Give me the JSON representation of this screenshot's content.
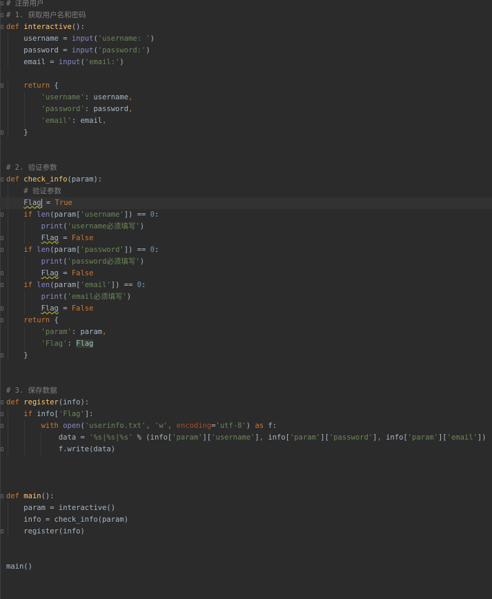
{
  "editor": {
    "language": "python",
    "theme": "dark",
    "current_line": 17,
    "lines": [
      {
        "indent": 0,
        "fold": true,
        "tokens": [
          {
            "t": "# 注册用户",
            "k": "cmt"
          }
        ]
      },
      {
        "indent": 0,
        "fold": true,
        "tokens": [
          {
            "t": "# 1. 获取用户名和密码",
            "k": "cmt"
          }
        ]
      },
      {
        "indent": 0,
        "fold": true,
        "tokens": [
          {
            "t": "def",
            "k": "kw"
          },
          {
            "t": " "
          },
          {
            "t": "interactive",
            "k": "fn"
          },
          {
            "t": "():"
          }
        ]
      },
      {
        "indent": 1,
        "tokens": [
          {
            "t": "username = "
          },
          {
            "t": "input",
            "k": "builtin"
          },
          {
            "t": "("
          },
          {
            "t": "'username: '",
            "k": "str"
          },
          {
            "t": ")"
          }
        ]
      },
      {
        "indent": 1,
        "tokens": [
          {
            "t": "password = "
          },
          {
            "t": "input",
            "k": "builtin"
          },
          {
            "t": "("
          },
          {
            "t": "'password:'",
            "k": "str"
          },
          {
            "t": ")"
          }
        ]
      },
      {
        "indent": 1,
        "tokens": [
          {
            "t": "email = "
          },
          {
            "t": "input",
            "k": "builtin"
          },
          {
            "t": "("
          },
          {
            "t": "'email:'",
            "k": "str"
          },
          {
            "t": ")"
          }
        ]
      },
      {
        "indent": 0,
        "tokens": []
      },
      {
        "indent": 1,
        "fold": true,
        "tokens": [
          {
            "t": "return",
            "k": "kw"
          },
          {
            "t": " {"
          }
        ]
      },
      {
        "indent": 2,
        "tokens": [
          {
            "t": "'username'",
            "k": "str"
          },
          {
            "t": ": username"
          },
          {
            "t": ",",
            "k": "kw"
          }
        ]
      },
      {
        "indent": 2,
        "tokens": [
          {
            "t": "'password'",
            "k": "str"
          },
          {
            "t": ": password"
          },
          {
            "t": ",",
            "k": "kw"
          }
        ]
      },
      {
        "indent": 2,
        "tokens": [
          {
            "t": "'email'",
            "k": "str"
          },
          {
            "t": ": email"
          },
          {
            "t": ",",
            "k": "kw"
          }
        ]
      },
      {
        "indent": 1,
        "fold": true,
        "tokens": [
          {
            "t": "}"
          }
        ]
      },
      {
        "indent": 0,
        "tokens": []
      },
      {
        "indent": 0,
        "tokens": []
      },
      {
        "indent": 0,
        "tokens": [
          {
            "t": "# 2. 验证参数",
            "k": "cmt"
          }
        ]
      },
      {
        "indent": 0,
        "fold": true,
        "tokens": [
          {
            "t": "def",
            "k": "kw"
          },
          {
            "t": " "
          },
          {
            "t": "check_info",
            "k": "fn"
          },
          {
            "t": "(param):"
          }
        ]
      },
      {
        "indent": 1,
        "tokens": [
          {
            "t": "# 验证参数",
            "k": "cmt"
          }
        ]
      },
      {
        "indent": 1,
        "tokens": [
          {
            "t": "Flag",
            "k": "warn"
          },
          {
            "t": "",
            "k": "caret"
          },
          {
            "t": " = "
          },
          {
            "t": "True",
            "k": "kw"
          }
        ]
      },
      {
        "indent": 1,
        "fold": true,
        "tokens": [
          {
            "t": "if",
            "k": "kw"
          },
          {
            "t": " "
          },
          {
            "t": "len",
            "k": "builtin"
          },
          {
            "t": "(param["
          },
          {
            "t": "'username'",
            "k": "str"
          },
          {
            "t": "]) == "
          },
          {
            "t": "0",
            "k": "num"
          },
          {
            "t": ":"
          }
        ]
      },
      {
        "indent": 2,
        "tokens": [
          {
            "t": "print",
            "k": "builtin"
          },
          {
            "t": "("
          },
          {
            "t": "'username必须填写'",
            "k": "str"
          },
          {
            "t": ")"
          }
        ]
      },
      {
        "indent": 2,
        "fold": true,
        "tokens": [
          {
            "t": "Flag",
            "k": "warn"
          },
          {
            "t": " = "
          },
          {
            "t": "False",
            "k": "kw"
          }
        ]
      },
      {
        "indent": 1,
        "fold": true,
        "tokens": [
          {
            "t": "if",
            "k": "kw"
          },
          {
            "t": " "
          },
          {
            "t": "len",
            "k": "builtin"
          },
          {
            "t": "(param["
          },
          {
            "t": "'password'",
            "k": "str"
          },
          {
            "t": "]) == "
          },
          {
            "t": "0",
            "k": "num"
          },
          {
            "t": ":"
          }
        ]
      },
      {
        "indent": 2,
        "tokens": [
          {
            "t": "print",
            "k": "builtin"
          },
          {
            "t": "("
          },
          {
            "t": "'password必须填写'",
            "k": "str"
          },
          {
            "t": ")"
          }
        ]
      },
      {
        "indent": 2,
        "fold": true,
        "tokens": [
          {
            "t": "Flag",
            "k": "warn"
          },
          {
            "t": " = "
          },
          {
            "t": "False",
            "k": "kw"
          }
        ]
      },
      {
        "indent": 1,
        "fold": true,
        "tokens": [
          {
            "t": "if",
            "k": "kw"
          },
          {
            "t": " "
          },
          {
            "t": "len",
            "k": "builtin"
          },
          {
            "t": "(param["
          },
          {
            "t": "'email'",
            "k": "str"
          },
          {
            "t": "]) == "
          },
          {
            "t": "0",
            "k": "num"
          },
          {
            "t": ":"
          }
        ]
      },
      {
        "indent": 2,
        "tokens": [
          {
            "t": "print",
            "k": "builtin"
          },
          {
            "t": "("
          },
          {
            "t": "'email必须填写'",
            "k": "str"
          },
          {
            "t": ")"
          }
        ]
      },
      {
        "indent": 2,
        "fold": true,
        "tokens": [
          {
            "t": "Flag",
            "k": "warn"
          },
          {
            "t": " = "
          },
          {
            "t": "False",
            "k": "kw"
          }
        ]
      },
      {
        "indent": 1,
        "fold": true,
        "tokens": [
          {
            "t": "return",
            "k": "kw"
          },
          {
            "t": " {"
          }
        ]
      },
      {
        "indent": 2,
        "tokens": [
          {
            "t": "'param'",
            "k": "str"
          },
          {
            "t": ": param"
          },
          {
            "t": ",",
            "k": "kw"
          }
        ]
      },
      {
        "indent": 2,
        "tokens": [
          {
            "t": "'Flag'",
            "k": "str"
          },
          {
            "t": ": "
          },
          {
            "t": "Flag",
            "k": "hl"
          }
        ]
      },
      {
        "indent": 1,
        "fold": true,
        "tokens": [
          {
            "t": "}"
          }
        ]
      },
      {
        "indent": 0,
        "tokens": []
      },
      {
        "indent": 0,
        "tokens": []
      },
      {
        "indent": 0,
        "tokens": [
          {
            "t": "# 3. 保存数据",
            "k": "cmt"
          }
        ]
      },
      {
        "indent": 0,
        "fold": true,
        "tokens": [
          {
            "t": "def",
            "k": "kw"
          },
          {
            "t": " "
          },
          {
            "t": "register",
            "k": "fn"
          },
          {
            "t": "(info):"
          }
        ]
      },
      {
        "indent": 1,
        "fold": true,
        "tokens": [
          {
            "t": "if",
            "k": "kw"
          },
          {
            "t": " info["
          },
          {
            "t": "'Flag'",
            "k": "str"
          },
          {
            "t": "]:"
          }
        ]
      },
      {
        "indent": 2,
        "fold": true,
        "tokens": [
          {
            "t": "with",
            "k": "kw"
          },
          {
            "t": " "
          },
          {
            "t": "open",
            "k": "builtin"
          },
          {
            "t": "("
          },
          {
            "t": "'userinfo.txt'",
            "k": "str"
          },
          {
            "t": ", ",
            "k": "kw"
          },
          {
            "t": "'w'",
            "k": "str"
          },
          {
            "t": ", ",
            "k": "kw"
          },
          {
            "t": "encoding",
            "k": "param"
          },
          {
            "t": "="
          },
          {
            "t": "'utf-8'",
            "k": "str"
          },
          {
            "t": ") "
          },
          {
            "t": "as",
            "k": "kw"
          },
          {
            "t": " f:"
          }
        ]
      },
      {
        "indent": 3,
        "tokens": [
          {
            "t": "data = "
          },
          {
            "t": "'%s|%s|%s'",
            "k": "str"
          },
          {
            "t": " % (info["
          },
          {
            "t": "'param'",
            "k": "str"
          },
          {
            "t": "]["
          },
          {
            "t": "'username'",
            "k": "str"
          },
          {
            "t": "]"
          },
          {
            "t": ", ",
            "k": "kw"
          },
          {
            "t": "info["
          },
          {
            "t": "'param'",
            "k": "str"
          },
          {
            "t": "]["
          },
          {
            "t": "'password'",
            "k": "str"
          },
          {
            "t": "]"
          },
          {
            "t": ", ",
            "k": "kw"
          },
          {
            "t": "info["
          },
          {
            "t": "'param'",
            "k": "str"
          },
          {
            "t": "]["
          },
          {
            "t": "'email'",
            "k": "str"
          },
          {
            "t": "])"
          }
        ]
      },
      {
        "indent": 3,
        "fold": true,
        "tokens": [
          {
            "t": "f.write(data)"
          }
        ]
      },
      {
        "indent": 0,
        "tokens": []
      },
      {
        "indent": 0,
        "tokens": []
      },
      {
        "indent": 0,
        "tokens": []
      },
      {
        "indent": 0,
        "fold": true,
        "tokens": [
          {
            "t": "def",
            "k": "kw"
          },
          {
            "t": " "
          },
          {
            "t": "main",
            "k": "fn"
          },
          {
            "t": "():"
          }
        ]
      },
      {
        "indent": 1,
        "tokens": [
          {
            "t": "param = interactive()"
          }
        ]
      },
      {
        "indent": 1,
        "tokens": [
          {
            "t": "info = check_info(param)"
          }
        ]
      },
      {
        "indent": 1,
        "fold": true,
        "tokens": [
          {
            "t": "register(info)"
          }
        ]
      },
      {
        "indent": 0,
        "tokens": []
      },
      {
        "indent": 0,
        "tokens": []
      },
      {
        "indent": 0,
        "tokens": [
          {
            "t": "main()"
          }
        ]
      }
    ]
  }
}
